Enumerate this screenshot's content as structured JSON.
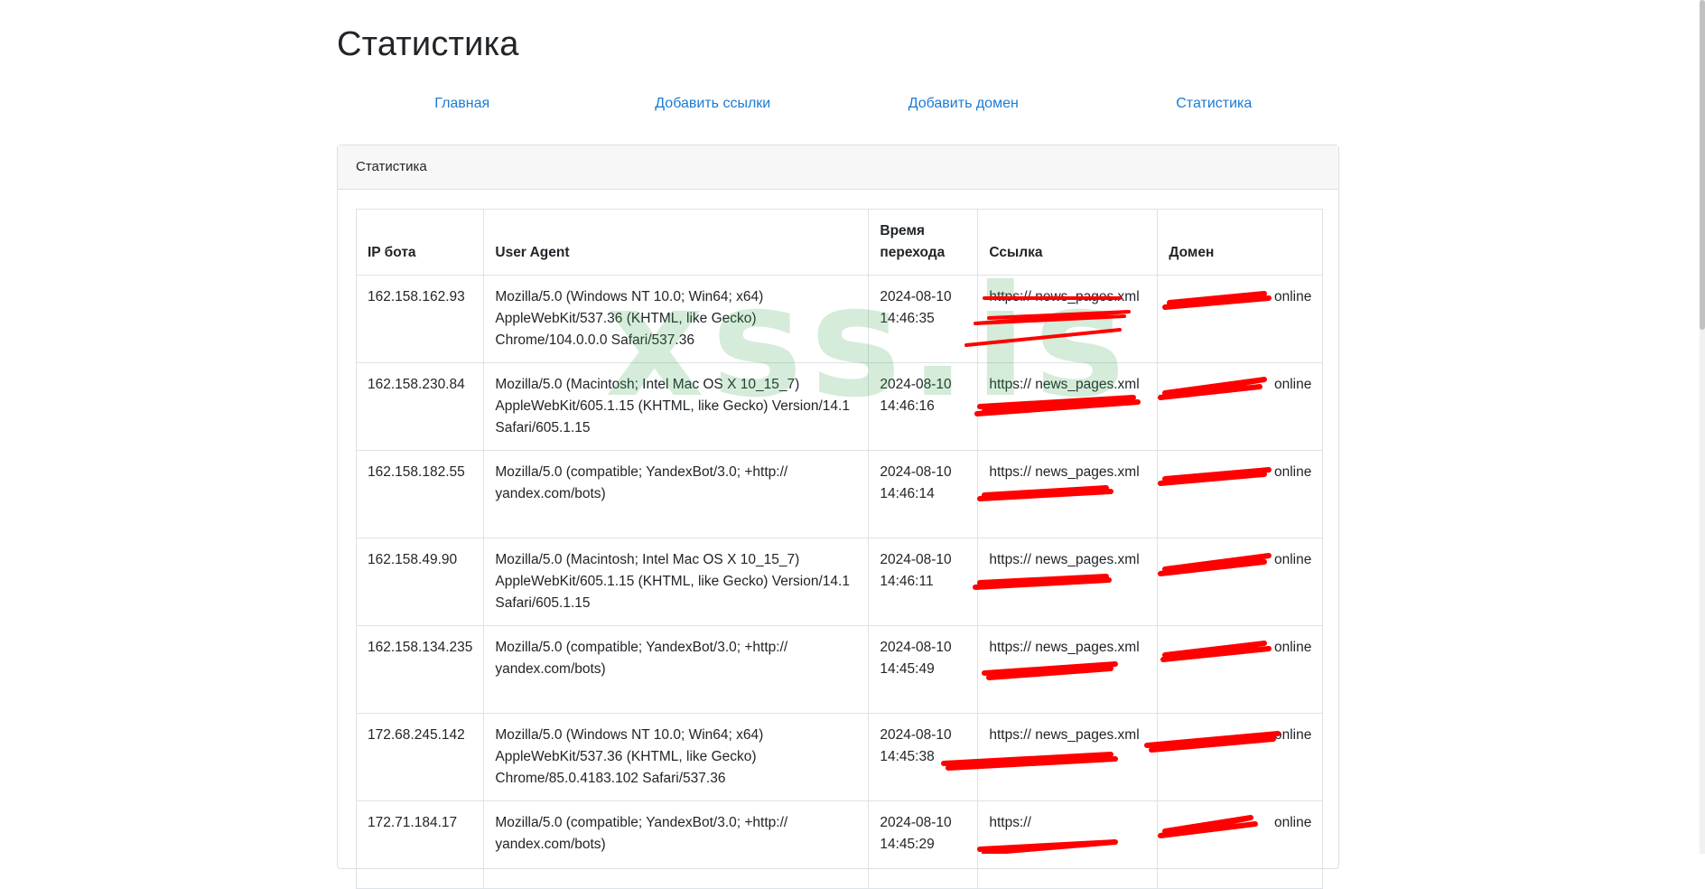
{
  "page": {
    "title": "Статистика",
    "nav": [
      "Главная",
      "Добавить ссылки",
      "Добавить домен",
      "Статистика"
    ],
    "watermark": "xss.is"
  },
  "card": {
    "header": "Статистика",
    "columns": [
      "IP бота",
      "User Agent",
      "Время перехода",
      "Ссылка",
      "Домен"
    ],
    "rows": [
      {
        "ip": "162.158.162.93",
        "ua": "Mozilla/5.0 (Windows NT 10.0; Win64; x64) AppleWebKit/537.36 (KHTML, like Gecko) Chrome/104.0.0.0 Safari/537.36",
        "time": "2024-08-10 14:46:35",
        "link": "https:// news_pages.xml",
        "domain": "online"
      },
      {
        "ip": "162.158.230.84",
        "ua": "Mozilla/5.0 (Macintosh; Intel Mac OS X 10_15_7) AppleWebKit/605.1.15 (KHTML, like Gecko) Version/14.1 Safari/605.1.15",
        "time": "2024-08-10 14:46:16",
        "link": "https:// news_pages.xml",
        "domain": "online"
      },
      {
        "ip": "162.158.182.55",
        "ua": "Mozilla/5.0 (compatible; YandexBot/3.0; +http:// yandex.com/bots)",
        "time": "2024-08-10 14:46:14",
        "link": "https:// news_pages.xml",
        "domain": "online"
      },
      {
        "ip": "162.158.49.90",
        "ua": "Mozilla/5.0 (Macintosh; Intel Mac OS X 10_15_7) AppleWebKit/605.1.15 (KHTML, like Gecko) Version/14.1 Safari/605.1.15",
        "time": "2024-08-10 14:46:11",
        "link": "https:// news_pages.xml",
        "domain": "online"
      },
      {
        "ip": "162.158.134.235",
        "ua": "Mozilla/5.0 (compatible; YandexBot/3.0; +http:// yandex.com/bots)",
        "time": "2024-08-10 14:45:49",
        "link": "https:// news_pages.xml",
        "domain": "online"
      },
      {
        "ip": "172.68.245.142",
        "ua": "Mozilla/5.0 (Windows NT 10.0; Win64; x64) AppleWebKit/537.36 (KHTML, like Gecko) Chrome/85.0.4183.102 Safari/537.36",
        "time": "2024-08-10 14:45:38",
        "link": "https:// news_pages.xml",
        "domain": "online"
      },
      {
        "ip": "172.71.184.17",
        "ua": "Mozilla/5.0 (compatible; YandexBot/3.0; +http:// yandex.com/bots)",
        "time": "2024-08-10 14:45:29",
        "link": "https://",
        "domain": "online"
      }
    ]
  },
  "colors": {
    "link": "#1a7bd6",
    "redaction": "#ff0000",
    "watermark": "#3caa50"
  }
}
